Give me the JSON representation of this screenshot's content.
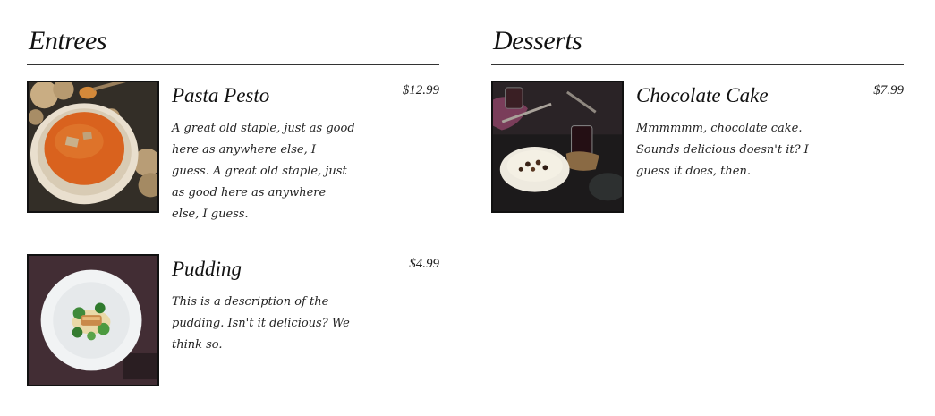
{
  "sections": [
    {
      "title": "Entrees",
      "items": [
        {
          "name": "Pasta Pesto",
          "price": "$12.99",
          "description": "A great old staple, just as good here as anywhere else, I guess. A great old staple, just as good here as anywhere else, I guess.",
          "image": "soup-bowl-image"
        },
        {
          "name": "Pudding",
          "price": "$4.99",
          "description": "This is a description of the pudding. Isn't it delicious? We think so.",
          "image": "plated-dish-image"
        }
      ]
    },
    {
      "title": "Desserts",
      "items": [
        {
          "name": "Chocolate Cake",
          "price": "$7.99",
          "description": "Mmmmmm, chocolate cake. Sounds delicious doesn't it? I guess it does, then.",
          "image": "dessert-bowl-image"
        }
      ]
    }
  ],
  "colors": {
    "text": "#222222",
    "rule": "#333333",
    "image_border": "#111111"
  }
}
